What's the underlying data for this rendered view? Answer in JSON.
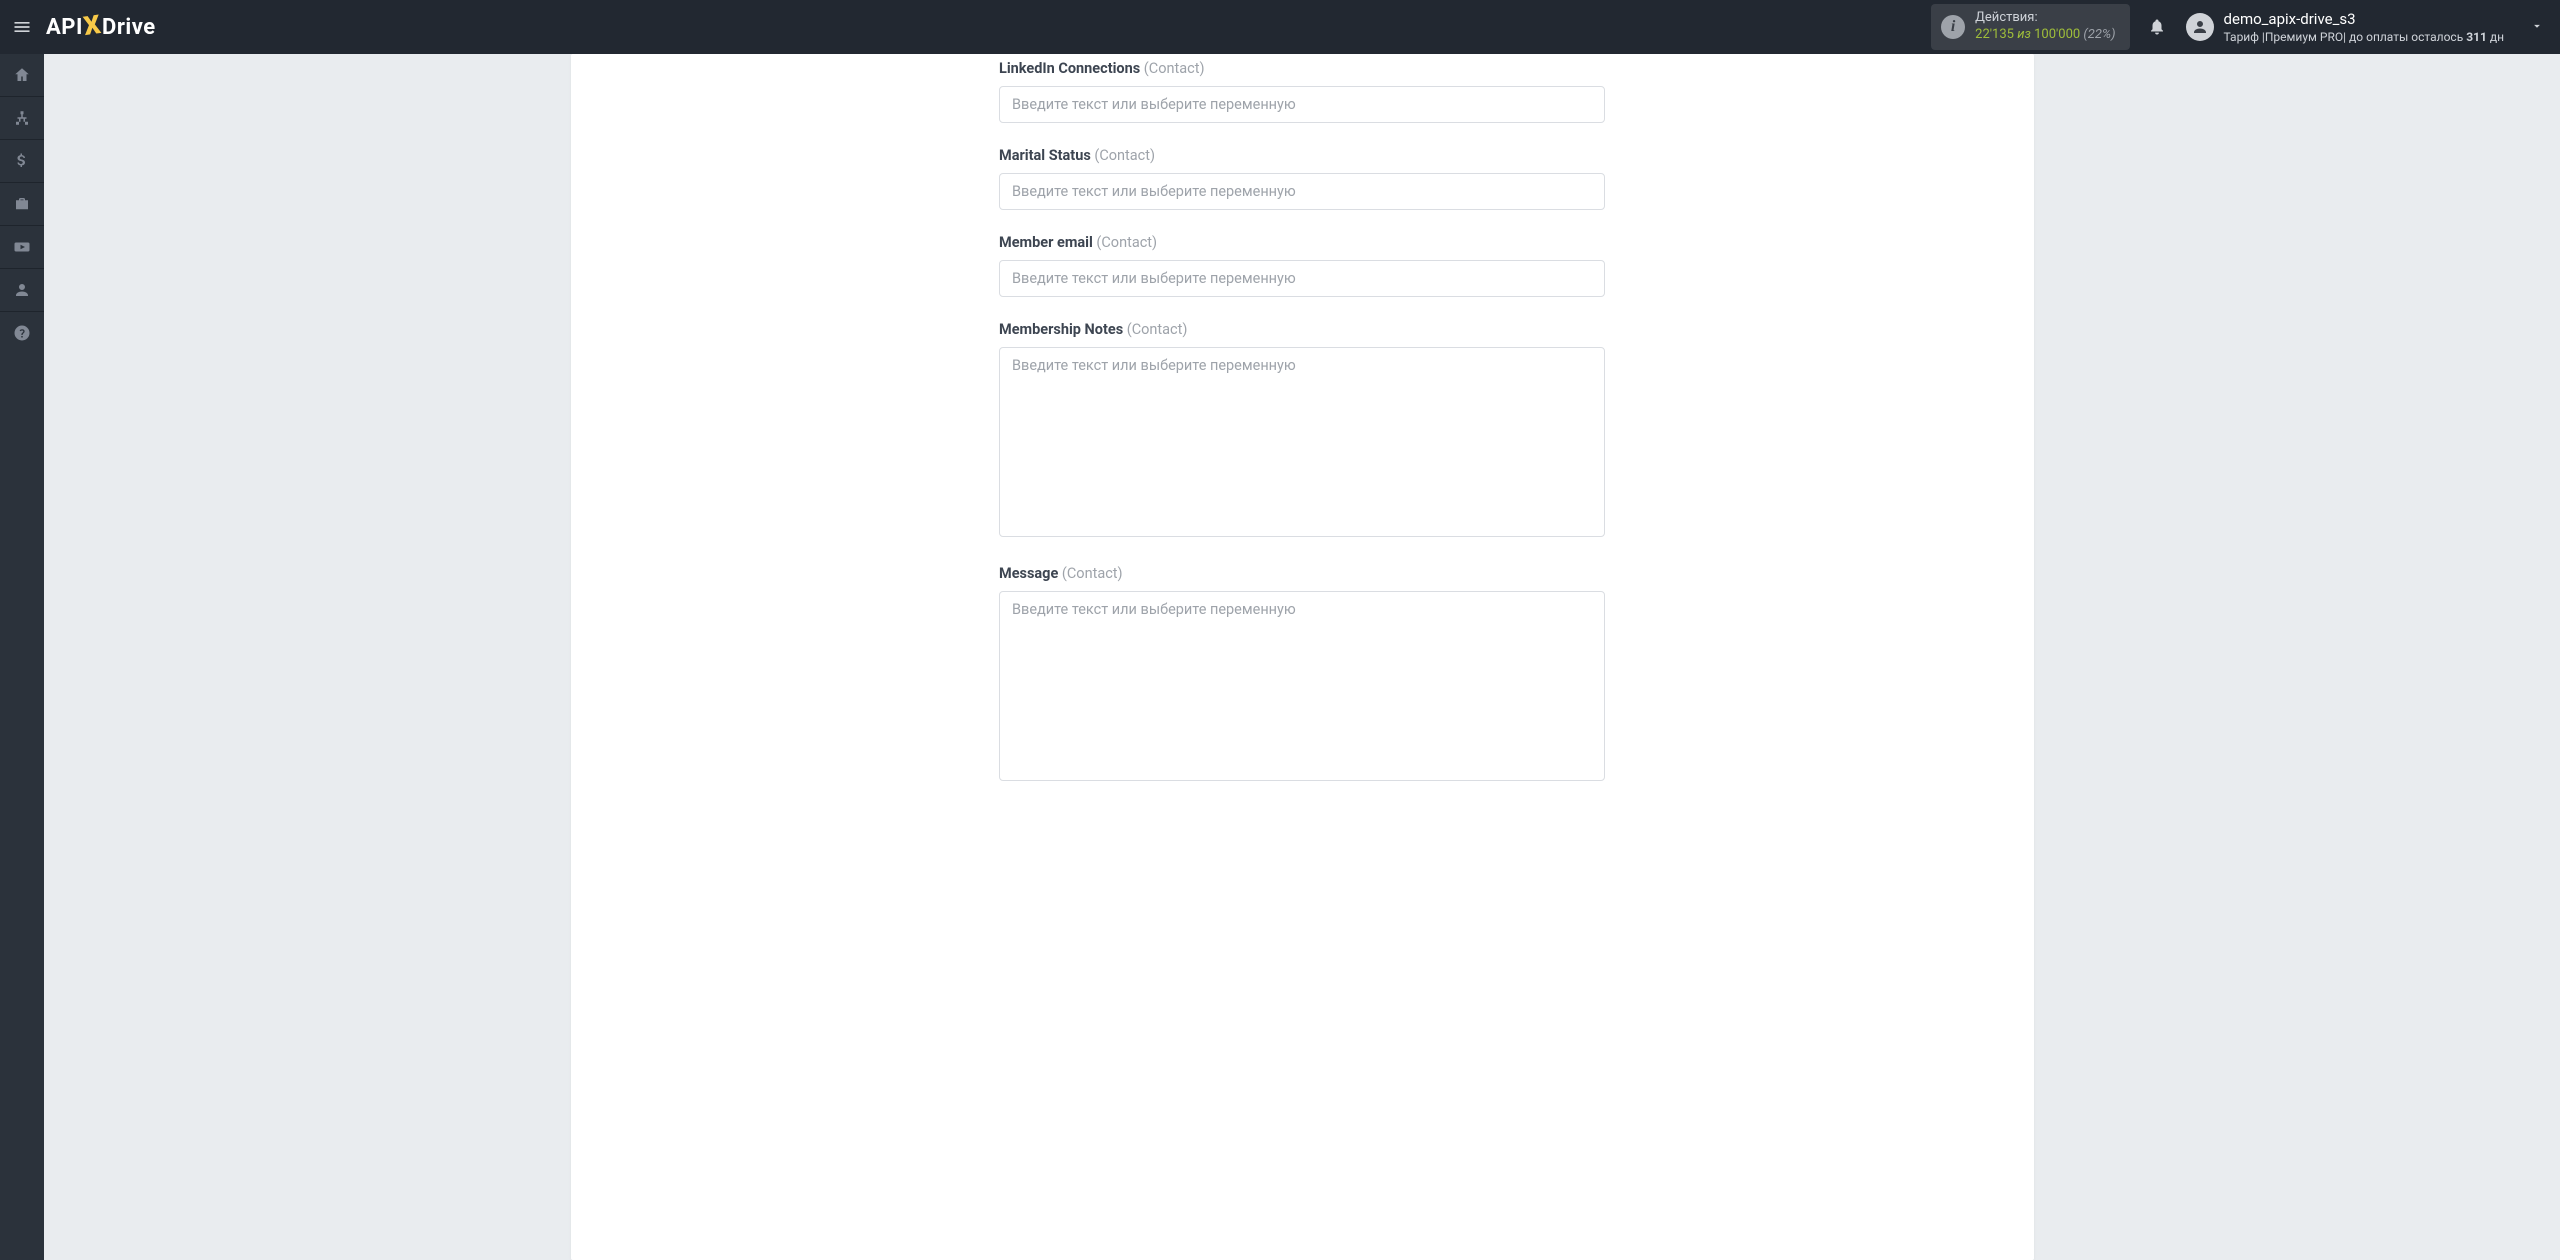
{
  "header": {
    "logo_prefix": "API",
    "logo_suffix": "Drive",
    "actions": {
      "title": "Действия:",
      "used": "22'135",
      "of_word": "из",
      "limit": "100'000",
      "percent": "(22%)"
    },
    "user": {
      "name": "demo_apix-drive_s3",
      "tariff_label": "Тариф |",
      "tariff_plan": "Премиум PRO",
      "sep": "|",
      "payment_prefix": " до оплаты осталось ",
      "payment_days": "311",
      "payment_suffix": " дн"
    }
  },
  "form": {
    "placeholder": "Введите текст или выберите переменную",
    "fields": [
      {
        "label": "LinkedIn Connections",
        "hint": "(Contact)",
        "type": "input",
        "name": "linkedin-connections"
      },
      {
        "label": "Marital Status",
        "hint": "(Contact)",
        "type": "input",
        "name": "marital-status"
      },
      {
        "label": "Member email",
        "hint": "(Contact)",
        "type": "input",
        "name": "member-email"
      },
      {
        "label": "Membership Notes",
        "hint": "(Contact)",
        "type": "textarea",
        "name": "membership-notes"
      },
      {
        "label": "Message",
        "hint": "(Contact)",
        "type": "textarea",
        "name": "message"
      }
    ]
  }
}
